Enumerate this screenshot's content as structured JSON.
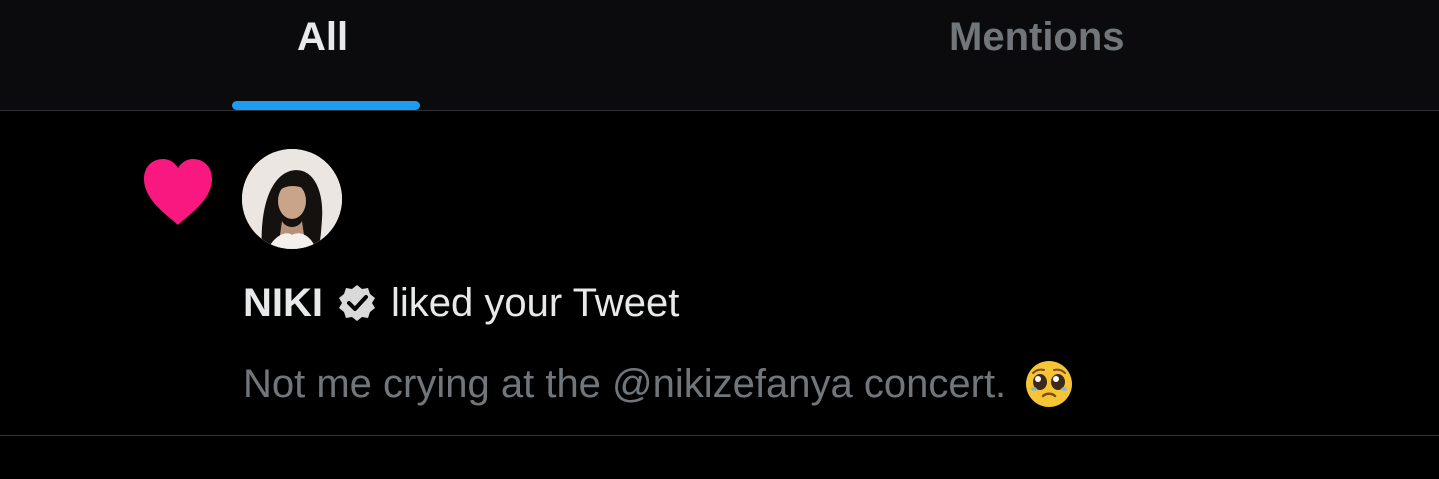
{
  "tabs": [
    {
      "label": "All",
      "selected": true
    },
    {
      "label": "Mentions",
      "selected": false
    }
  ],
  "colors": {
    "accent": "#1d9bf0",
    "like": "#f91880",
    "background": "#000000",
    "text_primary": "#e7e9ea",
    "text_secondary": "#71767b"
  },
  "notification": {
    "icon": "heart-icon",
    "avatar": "avatar",
    "user_name": "NIKI",
    "verified_icon": "verified-badge-icon",
    "action_text": "liked your Tweet",
    "tweet_text": "Not me crying at the @nikizefanya concert.",
    "tweet_emoji": "pleading-face-emoji-icon"
  }
}
